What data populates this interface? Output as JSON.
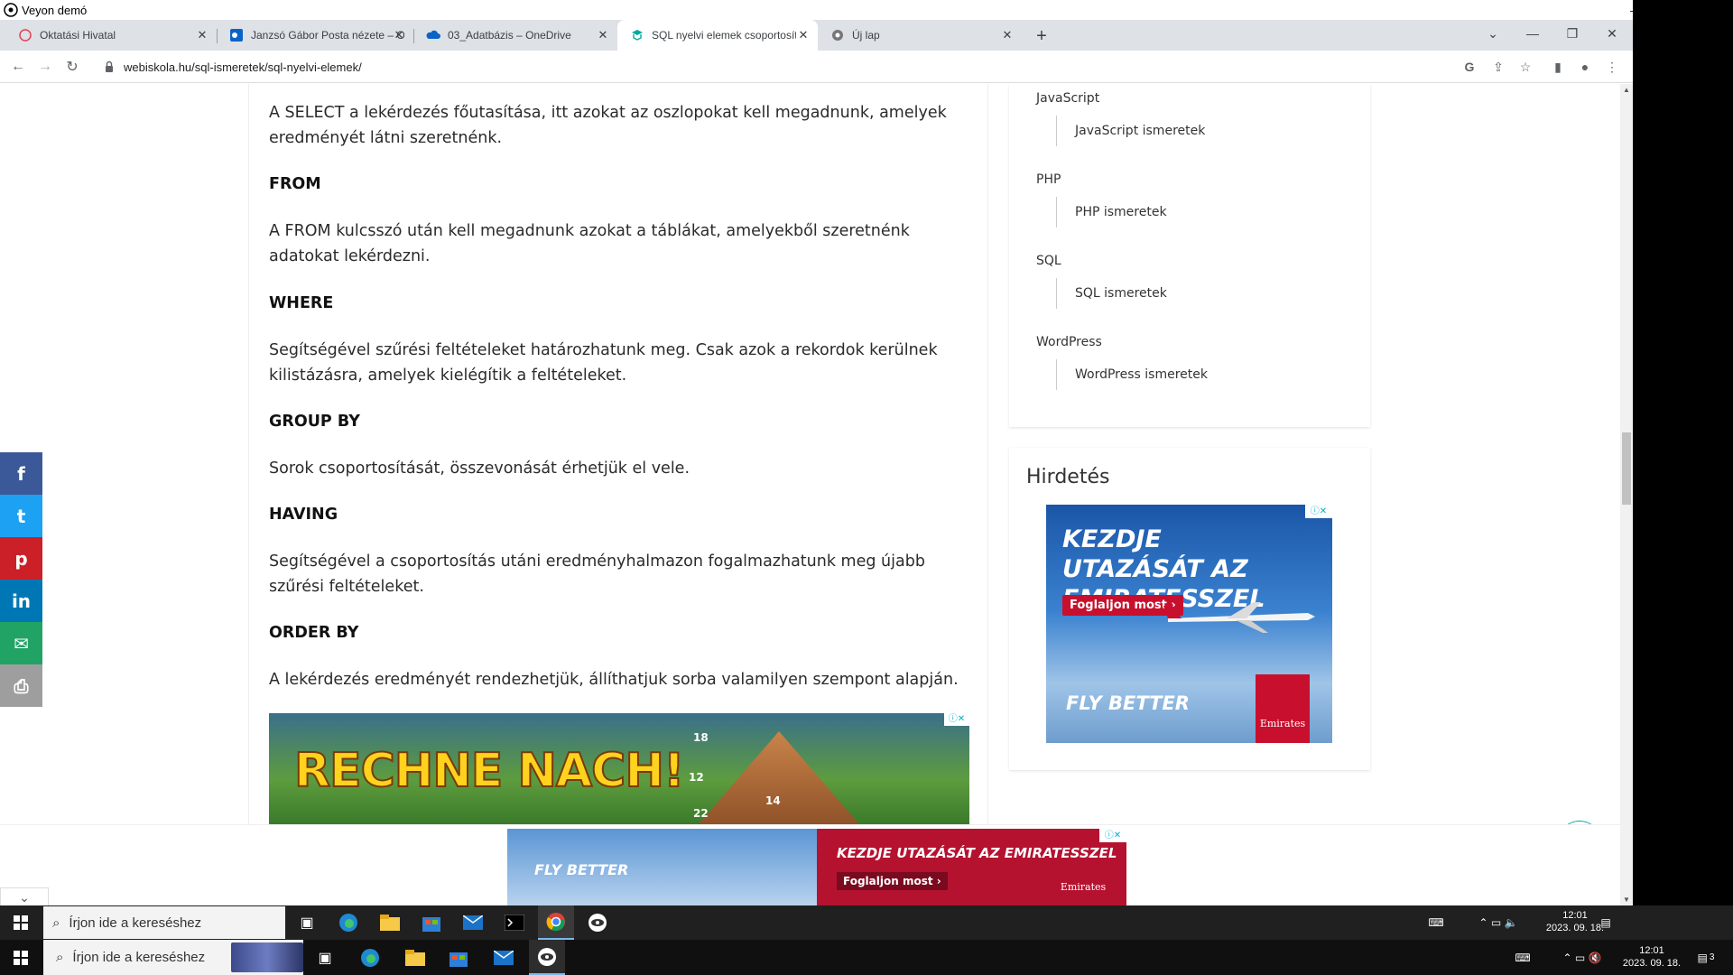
{
  "veyon": {
    "title": "Veyon demó"
  },
  "browser": {
    "tabs": [
      {
        "label": "Oktatási Hivatal",
        "favicon": "globe-icon"
      },
      {
        "label": "Janzsó Gábor Posta nézete – Ou",
        "favicon": "outlook-icon"
      },
      {
        "label": "03_Adatbázis – OneDrive",
        "favicon": "onedrive-icon"
      },
      {
        "label": "SQL nyelvi elemek csoportosítás",
        "favicon": "webiskola-icon",
        "active": true
      },
      {
        "label": "Új lap",
        "favicon": "chrome-icon"
      }
    ],
    "url": "webiskola.hu/sql-ismeretek/sql-nyelvi-elemek/"
  },
  "article": {
    "intro": "A SELECT a lekérdezés főutasítása, itt azokat az oszlopokat kell megadnunk, amelyek eredményét látni szeretnénk.",
    "sections": [
      {
        "heading": "FROM",
        "text": "A FROM kulcsszó után kell megadnunk azokat a táblákat, amelyekből szeretnénk adatokat lekérdezni."
      },
      {
        "heading": "WHERE",
        "text": "Segítségével szűrési feltételeket határozhatunk meg. Csak azok a rekordok kerülnek kilistázásra, amelyek kielégítik a feltételeket."
      },
      {
        "heading": "GROUP BY",
        "text": "Sorok csoportosítását, összevonását érhetjük el vele."
      },
      {
        "heading": "HAVING",
        "text": "Segítségével a csoportosítás utáni eredményhalmazon fogalmazhatunk meg újabb szűrési feltételeket."
      },
      {
        "heading": "ORDER BY",
        "text": "A lekérdezés eredményét rendezhetjük, állíthatjuk sorba valamilyen szempont alapján."
      }
    ],
    "ad": {
      "title": "RECHNE NACH!",
      "numbers": [
        "18",
        "12",
        "14",
        "22"
      ]
    }
  },
  "sidebar": {
    "categories": [
      {
        "name": "JavaScript",
        "sub": "JavaScript ismeretek"
      },
      {
        "name": "PHP",
        "sub": "PHP ismeretek"
      },
      {
        "name": "SQL",
        "sub": "SQL ismeretek"
      },
      {
        "name": "WordPress",
        "sub": "WordPress ismeretek"
      }
    ],
    "ad_heading": "Hirdetés",
    "emirates_ad": {
      "headline": "KEZDJE UTAZÁSÁT AZ EMIRATESSZEL",
      "cta": "Foglaljon most ›",
      "tagline": "FLY BETTER",
      "brand": "Emirates"
    }
  },
  "sticky_ad": {
    "tagline": "FLY BETTER",
    "headline": "KEZDJE UTAZÁSÁT AZ EMIRATESSZEL",
    "cta": "Foglaljon most ›",
    "brand": "Emirates"
  },
  "share": {
    "buttons": [
      {
        "name": "facebook",
        "glyph": "f",
        "color": "#3b5998"
      },
      {
        "name": "twitter",
        "glyph": "t",
        "color": "#1da1f2"
      },
      {
        "name": "pinterest",
        "glyph": "p",
        "color": "#cb2027"
      },
      {
        "name": "linkedin",
        "glyph": "in",
        "color": "#0077b5"
      },
      {
        "name": "email",
        "glyph": "✉",
        "color": "#21a366"
      },
      {
        "name": "print",
        "glyph": "⎙",
        "color": "#9e9e9e"
      }
    ]
  },
  "taskbar": {
    "search_placeholder": "Írjon ide a kereséshez",
    "inner_clock": {
      "time": "12:01",
      "date": "2023. 09. 18."
    },
    "outer_clock": {
      "time": "12:01",
      "date": "2023. 09. 18."
    },
    "notification_count": "3"
  },
  "colors": {
    "accent_chat": "#00c2b8",
    "emirates_red": "#c8102e",
    "chrome_tabstrip": "#dee1e6"
  }
}
